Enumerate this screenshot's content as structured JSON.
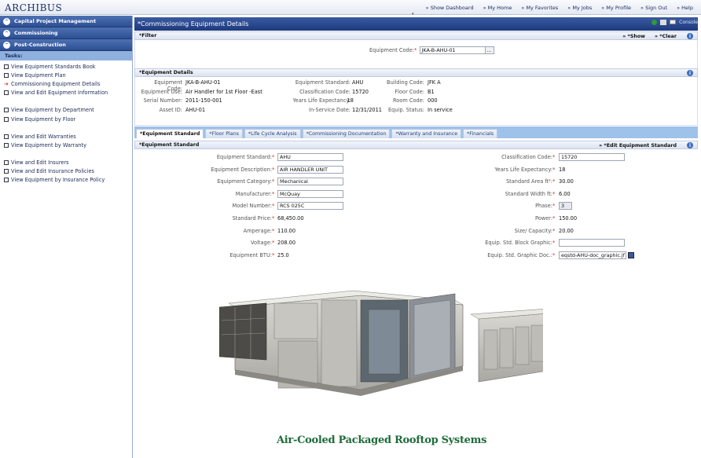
{
  "app": {
    "logo": "ARCHIBUS",
    "top_nav": [
      "» Show Dashboard",
      "» My Home",
      "» My Favorites",
      "» My Jobs",
      "» My Profile",
      "» Sign Out",
      "» Help"
    ]
  },
  "sidebar": {
    "sections": [
      "Capital Project Management",
      "Commissioning",
      "Post-Construction"
    ],
    "tasks_label": "Tasks:",
    "groups": [
      [
        {
          "label": "View Equipment Standards Book",
          "active": false
        },
        {
          "label": "View Equipment Plan",
          "active": false
        },
        {
          "label": "Commissioning Equipment Details",
          "active": true
        },
        {
          "label": "View and Edit Equipment Information",
          "active": false
        }
      ],
      [
        {
          "label": "View Equipment by Department",
          "active": false
        },
        {
          "label": "View Equipment by Floor",
          "active": false
        }
      ],
      [
        {
          "label": "View and Edit Warranties",
          "active": false
        },
        {
          "label": "View Equipment by Warranty",
          "active": false
        }
      ],
      [
        {
          "label": "View and Edit Insurers",
          "active": false
        },
        {
          "label": "View and Edit Insurance Policies",
          "active": false
        },
        {
          "label": "View Equipment by Insurance Policy",
          "active": false
        }
      ]
    ]
  },
  "panel": {
    "title": "*Commissioning Equipment Details",
    "console_label": "Console"
  },
  "filter": {
    "header": "*Filter",
    "show_label": "» *Show",
    "clear_label": "» *Clear",
    "equipment_code_label": "Equipment Code:",
    "equipment_code_value": "JKA-B-AHU-01",
    "browse_label": "..."
  },
  "details": {
    "header": "*Equipment Details",
    "col1": [
      {
        "label": "Equipment Code:",
        "value": "JKA-B-AHU-01"
      },
      {
        "label": "Equipment Use:",
        "value": "Air Handler for 1st Floor -East"
      },
      {
        "label": "Serial Number:",
        "value": "2011-150-001"
      },
      {
        "label": "Asset ID:",
        "value": "AHU-01"
      }
    ],
    "col2": [
      {
        "label": "Equipment Standard:",
        "value": "AHU"
      },
      {
        "label": "Classification Code:",
        "value": "15720"
      },
      {
        "label": "Years Life Expectancy:",
        "value": "18"
      },
      {
        "label": "In-Service Date:",
        "value": "12/31/2011"
      }
    ],
    "col3": [
      {
        "label": "Building Code:",
        "value": "JFK A"
      },
      {
        "label": "Floor Code:",
        "value": "B1"
      },
      {
        "label": "Room Code:",
        "value": "000"
      },
      {
        "label": "Equip. Status:",
        "value": "In service"
      }
    ]
  },
  "tabs": [
    "*Equipment Standard",
    "*Floor Plans",
    "*Life Cycle Analysis",
    "*Commissioning Documentation",
    "*Warranty and Insurance",
    "*Financials"
  ],
  "standard": {
    "header": "*Equipment Standard",
    "edit_label": "» *Edit Equipment Standard",
    "left": [
      {
        "label": "Equipment Standard:",
        "value": "AHU",
        "input": true
      },
      {
        "label": "Equipment Description:",
        "value": "AIR HANDLER UNIT",
        "input": true
      },
      {
        "label": "Equipment Category:",
        "value": "Mechanical",
        "input": true
      },
      {
        "label": "Manufacturer:",
        "value": "McQuay",
        "input": true
      },
      {
        "label": "Model Number:",
        "value": "RCS 025C",
        "input": true
      },
      {
        "label": "Standard Price:",
        "value": "68,450.00",
        "input": false
      },
      {
        "label": "Amperage:",
        "value": "110.00",
        "input": false
      },
      {
        "label": "Voltage:",
        "value": "208.00",
        "input": false
      },
      {
        "label": "Equipment BTU:",
        "value": "25.0",
        "input": false
      }
    ],
    "right": [
      {
        "label": "Classification Code:",
        "value": "15720",
        "input": true
      },
      {
        "label": "Years Life Expectancy:",
        "value": "18",
        "input": false
      },
      {
        "label": "Standard Area ft²:",
        "value": "30.00",
        "input": false
      },
      {
        "label": "Standard Width ft:",
        "value": "6.00",
        "input": false
      },
      {
        "label": "Phase:",
        "value": "3",
        "input": "select"
      },
      {
        "label": "Power:",
        "value": "150.00",
        "input": false
      },
      {
        "label": "Size/ Capacity:",
        "value": "20.00",
        "input": false
      },
      {
        "label": "Equip. Std. Block Graphic:",
        "value": "",
        "input": true
      },
      {
        "label": "Equip. Std. Graphic Doc.:",
        "value": "eqstd-AHU-doc_graphic.jf",
        "input": "doc"
      }
    ],
    "image_caption": "Air-Cooled Packaged Rooftop Systems"
  }
}
